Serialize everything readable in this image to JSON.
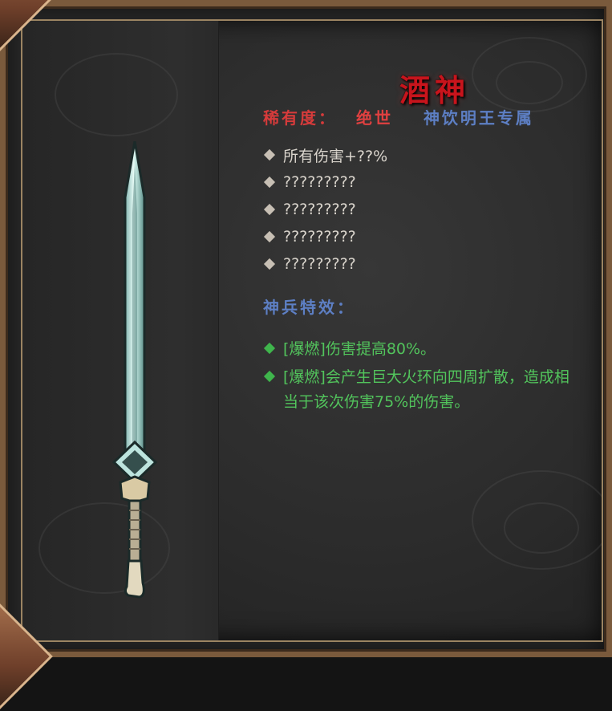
{
  "item": {
    "name": "酒神",
    "rarity_label": "稀有度：",
    "rarity_value": "绝世",
    "exclusive": "神饮明王专属"
  },
  "stats": [
    "所有伤害+??%",
    "?????????",
    "?????????",
    "?????????",
    "?????????"
  ],
  "special": {
    "title": "神兵特效：",
    "effects": [
      "[爆燃]伤害提高80%。",
      "[爆燃]会产生巨大火环向四周扩散，造成相当于该次伤害75%的伤害。"
    ]
  },
  "colors": {
    "title": "#c8141c",
    "rarity": "#e04040",
    "exclusive": "#5d7fc4",
    "stat_text": "#d9d4cc",
    "effect_text": "#52c45c",
    "frame": "#7a5a3c"
  },
  "icons": {
    "weapon": "sword-icon",
    "stat_bullet": "diamond-bullet-icon",
    "effect_bullet": "green-diamond-bullet-icon"
  }
}
